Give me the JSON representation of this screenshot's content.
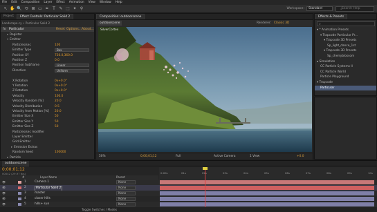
{
  "menubar": [
    "File",
    "Edit",
    "Composition",
    "Layer",
    "Effect",
    "Animation",
    "View",
    "Window",
    "Help"
  ],
  "toolbar": {
    "tools": [
      "↖",
      "✋",
      "🔍",
      "⟲",
      "⊞",
      "▭",
      "✒",
      "T",
      "✎",
      "⬚",
      "✦",
      "⚲"
    ],
    "workspace_label": "Workspace:",
    "workspace_value": "Standard",
    "search_placeholder": "Search Help"
  },
  "effect_controls": {
    "tabs": [
      "Project",
      "Effect Controls: Particular Solid 2"
    ],
    "breadcrumb": "Landscape.cy • Particular Solid 2",
    "effect_name": "Particular",
    "effect_links": [
      "Reset",
      "Options...",
      "About..."
    ],
    "rows": [
      {
        "indent": 1,
        "twirl": "▸",
        "label": "Register",
        "val": ""
      },
      {
        "indent": 1,
        "twirl": "▾",
        "label": "Emitter",
        "val": ""
      },
      {
        "indent": 2,
        "twirl": "",
        "label": "Particles/sec",
        "val": "100"
      },
      {
        "indent": 2,
        "twirl": "",
        "label": "Emitter Type",
        "sel": "Box"
      },
      {
        "indent": 2,
        "twirl": "",
        "label": "Position XY",
        "val": "720.0,360.0"
      },
      {
        "indent": 2,
        "twirl": "",
        "label": "Position Z",
        "val": "0.0"
      },
      {
        "indent": 2,
        "twirl": "",
        "label": "Position Subframe",
        "sel": "Linear"
      },
      {
        "indent": 2,
        "twirl": "",
        "label": "Direction",
        "sel": "Uniform"
      },
      {
        "indent": 2,
        "twirl": "",
        "label": "",
        "val": ""
      },
      {
        "indent": 2,
        "twirl": "",
        "label": "X Rotation",
        "val": "0x+0.0°"
      },
      {
        "indent": 2,
        "twirl": "",
        "label": "Y Rotation",
        "val": "0x+0.0°"
      },
      {
        "indent": 2,
        "twirl": "",
        "label": "Z Rotation",
        "val": "0x+0.0°"
      },
      {
        "indent": 2,
        "twirl": "",
        "label": "Velocity",
        "val": "100.0"
      },
      {
        "indent": 2,
        "twirl": "",
        "label": "Velocity Random [%]",
        "val": "20.0"
      },
      {
        "indent": 2,
        "twirl": "",
        "label": "Velocity Distribution",
        "val": "0.5"
      },
      {
        "indent": 2,
        "twirl": "",
        "label": "Velocity from Motion [%]",
        "val": "20.0"
      },
      {
        "indent": 2,
        "twirl": "",
        "label": "Emitter Size X",
        "val": "50"
      },
      {
        "indent": 2,
        "twirl": "",
        "label": "Emitter Size Y",
        "val": "50"
      },
      {
        "indent": 2,
        "twirl": "",
        "label": "Emitter Size Z",
        "val": "50"
      },
      {
        "indent": 2,
        "twirl": "",
        "label": "Particles/sec modifier",
        "val": ""
      },
      {
        "indent": 2,
        "twirl": "",
        "label": "Layer Emitter",
        "val": ""
      },
      {
        "indent": 2,
        "twirl": "",
        "label": "Grid Emitter",
        "val": ""
      },
      {
        "indent": 2,
        "twirl": "▸",
        "label": "Emission Extras",
        "val": ""
      },
      {
        "indent": 2,
        "twirl": "",
        "label": "Random Seed",
        "val": "100000"
      },
      {
        "indent": 1,
        "twirl": "▸",
        "label": "Particle",
        "val": ""
      }
    ]
  },
  "composition": {
    "tab": "Composition: outdoorscene",
    "sub_tab": "outdoorscene",
    "renderer_label": "Renderer:",
    "renderer_value": "Classic 3D",
    "viewer_label": "SilverCortex",
    "footer": [
      "50%",
      "▾",
      "0;00;01;12",
      "Full",
      "Active Camera",
      "1 View",
      "+0.0"
    ]
  },
  "project": {
    "tab": "Effects & Presets",
    "search_placeholder": "",
    "tree": [
      {
        "indent": 0,
        "label": "▾ * Animation Presets"
      },
      {
        "indent": 1,
        "label": "▾ Trapcode Particular Pr..."
      },
      {
        "indent": 2,
        "label": "▾ Trapcode 3D Presets"
      },
      {
        "indent": 3,
        "label": "Sp_light_dance_1st"
      },
      {
        "indent": 2,
        "label": "▾ Trapcode 3D Presets"
      },
      {
        "indent": 3,
        "label": "Sp_cherryblossom"
      },
      {
        "indent": 0,
        "label": "▸ Simulation"
      },
      {
        "indent": 1,
        "label": "CC Particle Systems II"
      },
      {
        "indent": 1,
        "label": "CC Particle World"
      },
      {
        "indent": 1,
        "label": "Particle Playground"
      },
      {
        "indent": 0,
        "label": "▾ Trapcode"
      },
      {
        "indent": 1,
        "label": "Particular",
        "highlight": true
      }
    ]
  },
  "timeline": {
    "tab": "outdoorscene",
    "timecode": "0;00;01;12",
    "frames": "00042 (29.97 fps)",
    "columns": [
      "#",
      "Layer Name",
      "Mode",
      "T",
      "TrkMat",
      "Parent"
    ],
    "ruler": [
      "0:00s",
      "01s",
      "02s",
      "03s",
      "04s",
      "05s",
      "06s",
      "07s",
      "08s",
      "09s",
      "10s"
    ],
    "layers": [
      {
        "num": "1",
        "name": "Camera 1",
        "parent": "None",
        "color": "#e0a0a0"
      },
      {
        "num": "2",
        "name": "Particular Solid 2",
        "parent": "None",
        "color": "#d96a6a",
        "selected": true
      },
      {
        "num": "3",
        "name": "master",
        "parent": "None",
        "color": "#8a8ab0"
      },
      {
        "num": "4",
        "name": "closer hills",
        "parent": "None",
        "color": "#8a8ab0"
      },
      {
        "num": "5",
        "name": "hills+ sun",
        "parent": "None",
        "color": "#8a8ab0"
      }
    ],
    "footer": "Toggle Switches / Modes"
  }
}
